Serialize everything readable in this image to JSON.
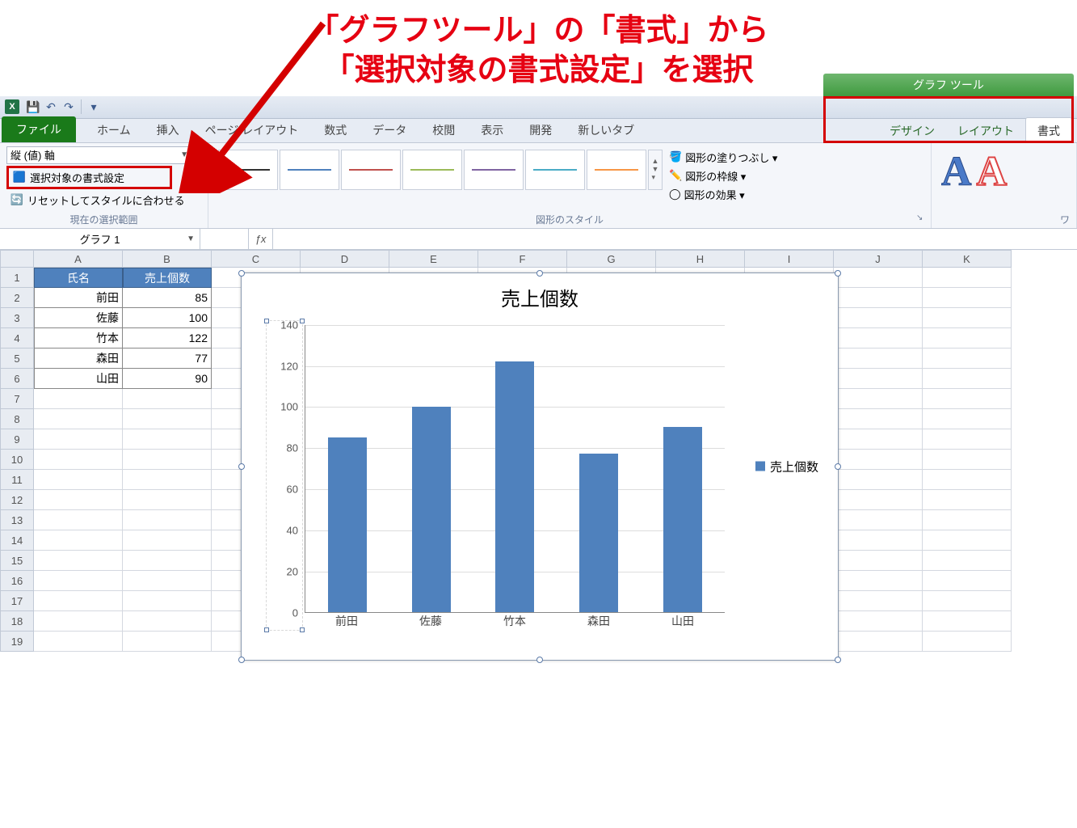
{
  "annotation": {
    "line1": "「グラフツール」の「書式」から",
    "line2": "「選択対象の書式設定」を選択"
  },
  "qat": {
    "undo": "↶",
    "redo": "↷"
  },
  "tabs": {
    "file": "ファイル",
    "list": [
      "ホーム",
      "挿入",
      "ページ レイアウト",
      "数式",
      "データ",
      "校閲",
      "表示",
      "開発",
      "新しいタブ"
    ]
  },
  "chartTools": {
    "title": "グラフ ツール",
    "tabs": [
      "デザイン",
      "レイアウト",
      "書式"
    ],
    "active": 2
  },
  "ribbon": {
    "selection": {
      "dropdown_value": "縦 (値) 軸",
      "format_selection": "選択対象の書式設定",
      "reset": "リセットしてスタイルに合わせる",
      "group_label": "現在の選択範囲"
    },
    "shapeStyles": {
      "group_label": "図形のスタイル",
      "fill": "図形の塗りつぶし ▾",
      "outline": "図形の枠線 ▾",
      "effects": "図形の効果 ▾"
    },
    "wordart_group_label": "ワ"
  },
  "formulaBar": {
    "name_box": "グラフ 1",
    "fx": "ƒx",
    "formula": ""
  },
  "columns": [
    "A",
    "B",
    "C",
    "D",
    "E",
    "F",
    "G",
    "H",
    "I",
    "J",
    "K"
  ],
  "rowCount": 19,
  "table": {
    "headers": [
      "氏名",
      "売上個数"
    ],
    "rows": [
      {
        "name": "前田",
        "val": "85"
      },
      {
        "name": "佐藤",
        "val": "100"
      },
      {
        "name": "竹本",
        "val": "122"
      },
      {
        "name": "森田",
        "val": "77"
      },
      {
        "name": "山田",
        "val": "90"
      }
    ]
  },
  "chart_data": {
    "type": "bar",
    "title": "売上個数",
    "categories": [
      "前田",
      "佐藤",
      "竹本",
      "森田",
      "山田"
    ],
    "values": [
      85,
      100,
      122,
      77,
      90
    ],
    "ylim": [
      0,
      140
    ],
    "yticks": [
      0,
      20,
      40,
      60,
      80,
      100,
      120,
      140
    ],
    "legend": "売上個数",
    "xlabel": "",
    "ylabel": ""
  }
}
